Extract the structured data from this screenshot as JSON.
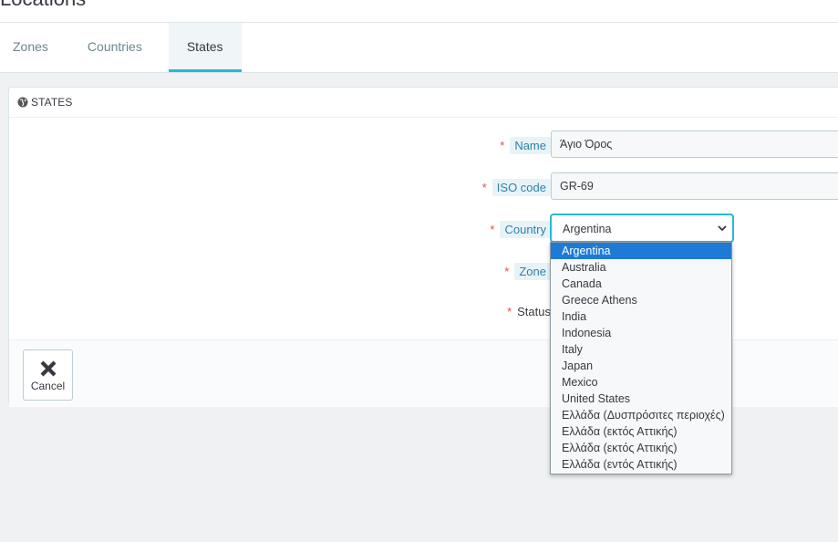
{
  "header": {
    "title_partial": "Locations",
    "tabs": [
      {
        "label": "Zones",
        "active": false
      },
      {
        "label": "Countries",
        "active": false
      },
      {
        "label": "States",
        "active": true
      }
    ]
  },
  "panel": {
    "heading": "STATES",
    "heading_icon": "globe-icon",
    "fields": {
      "name": {
        "label": "Name",
        "value": "Άγιο Όρος",
        "required": true
      },
      "iso": {
        "label": "ISO code",
        "value": "GR-69",
        "required": true
      },
      "country": {
        "label": "Country",
        "value": "Argentina",
        "required": true
      },
      "zone": {
        "label": "Zone",
        "required": true
      },
      "status": {
        "label": "Status",
        "required": true
      }
    },
    "required_mark": "*",
    "cancel_label": "Cancel"
  },
  "country_options": [
    "Argentina",
    "Australia",
    "Canada",
    "Greece Athens",
    "India",
    "Indonesia",
    "Italy",
    "Japan",
    "Mexico",
    "United States",
    "Ελλάδα (Δυσπρόσιτες περιοχές)",
    "Ελλάδα (εκτός Αττικής)",
    "Ελλάδα (εκτός Αττικής)",
    "Ελλάδα (εντός Αττικής)"
  ],
  "colors": {
    "accent": "#25b9d7",
    "required": "#e24c4c",
    "selected_option": "#1e7ad7"
  }
}
